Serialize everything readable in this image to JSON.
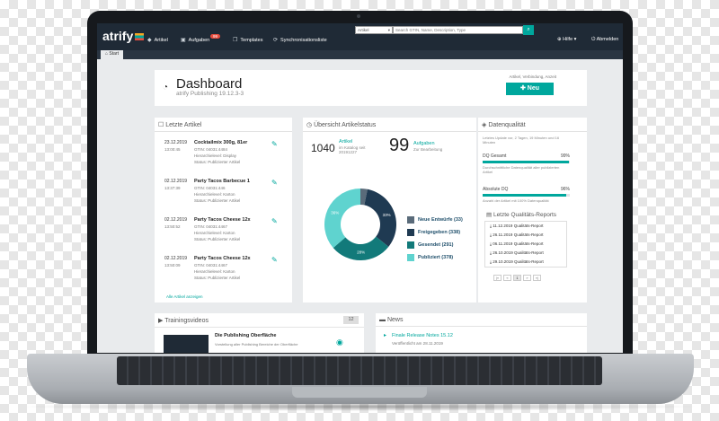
{
  "app": {
    "logo": "atrify",
    "nav": [
      {
        "label": "Artikel",
        "icon": "tag-icon"
      },
      {
        "label": "Aufgaben",
        "icon": "inbox-icon",
        "badge": "99"
      },
      {
        "label": "Templates",
        "icon": "copy-icon"
      },
      {
        "label": "Synchronisationsliste",
        "icon": "sync-icon"
      }
    ],
    "search": {
      "scope": "Artikel",
      "placeholder": "Search GTIN, Name, Description, Type"
    },
    "help": "Hilfe",
    "logout": "Abmelden",
    "tab": "Start"
  },
  "header": {
    "title": "Dashboard",
    "subtitle": "atrify Publishing 19.12.3-3",
    "new_hint": "Artikel, Verbindung, Anzeit",
    "new_button": "Neu"
  },
  "articles": {
    "title": "Letzte Artikel",
    "items": [
      {
        "date": "23.12.2019",
        "time": "13:00:45",
        "name": "Cocktailmix 300g, 81er",
        "gtin": "GTIN: 04031:4484",
        "level": "Hierarchielevel: Display",
        "status": "Status: Publizierter Artikel"
      },
      {
        "date": "02.12.2019",
        "time": "13:37:39",
        "name": "Party Tacos Barbecue 1",
        "gtin": "GTIN: 04031:446",
        "level": "Hierarchielevel: Karton",
        "status": "Status: Publizierter Artikel"
      },
      {
        "date": "02.12.2019",
        "time": "13:50:52",
        "name": "Party Tacos Cheese 12x",
        "gtin": "GTIN: 04031:4467",
        "level": "Hierarchielevel: Karton",
        "status": "Status: Publizierter Artikel"
      },
      {
        "date": "02.12.2019",
        "time": "13:50:09",
        "name": "Party Tacos Cheese 12x",
        "gtin": "GTIN: 04031:4467",
        "level": "Hierarchielevel: Karton",
        "status": "Status: Publizierter Artikel"
      }
    ],
    "all_link": "Alle Artikel anzeigen"
  },
  "status": {
    "title": "Übersicht Artikelstatus",
    "articles_count": "1040",
    "articles_label": "Artikel",
    "articles_sub": "im Katalog seit 20191227",
    "tasks_count": "99",
    "tasks_label": "Aufgaben",
    "tasks_sub": "Zur Bearbeitung",
    "legend": [
      {
        "label": "Neue Entwürfe (33)",
        "color": "#5a6b7a"
      },
      {
        "label": "Freigegeben (338)",
        "color": "#1f3a52"
      },
      {
        "label": "Gesendet (291)",
        "color": "#127a7a"
      },
      {
        "label": "Publiziert (378)",
        "color": "#5fd3cf"
      }
    ]
  },
  "chart_data": {
    "type": "pie",
    "categories": [
      "Neue Entwürfe",
      "Freigegeben",
      "Gesendet",
      "Publiziert"
    ],
    "values": [
      33,
      338,
      291,
      378
    ],
    "data_labels": [
      "",
      "33%",
      "28%",
      "36%"
    ],
    "colors": [
      "#5a6b7a",
      "#1f3a52",
      "#127a7a",
      "#5fd3cf"
    ],
    "donut": true
  },
  "quality": {
    "title": "Datenqualität",
    "note": "Letztes Update vor, 2 Tagen, 19 Minuten und 16 Minuten",
    "dq_label": "DQ Gesamt",
    "dq_value": "99%",
    "dq_fraction": 0.99,
    "dq_note": "Durchschnittliche Datenqualität aller publizierten Artikel",
    "abs_label": "Absolute DQ",
    "abs_value": "96%",
    "abs_fraction": 0.96,
    "abs_note": "Anzahl der Artikel mit 100% Datenqualität",
    "reports_title": "Letzte Qualitäts-Reports",
    "reports": [
      "11.12.2019 Qualitäts-Report",
      "26.11.2019 Qualitäts-Report",
      "06.11.2019 Qualitäts-Report",
      "26.10.2019 Qualitäts-Report",
      "29.10.2019 Qualitäts-Report"
    ],
    "pager": [
      "|«",
      "«",
      "1",
      "»",
      "»|"
    ]
  },
  "videos": {
    "title": "Trainingsvideos",
    "count": "12",
    "item_title": "Die Publishing Oberfläche",
    "item_desc": "Vorstellung aller Publishing Bereiche der Oberfläche"
  },
  "news": {
    "title": "News",
    "item_title": "Finale Release Notes 15.12",
    "item_date": "Veröffentlicht am 28.11.2019"
  }
}
